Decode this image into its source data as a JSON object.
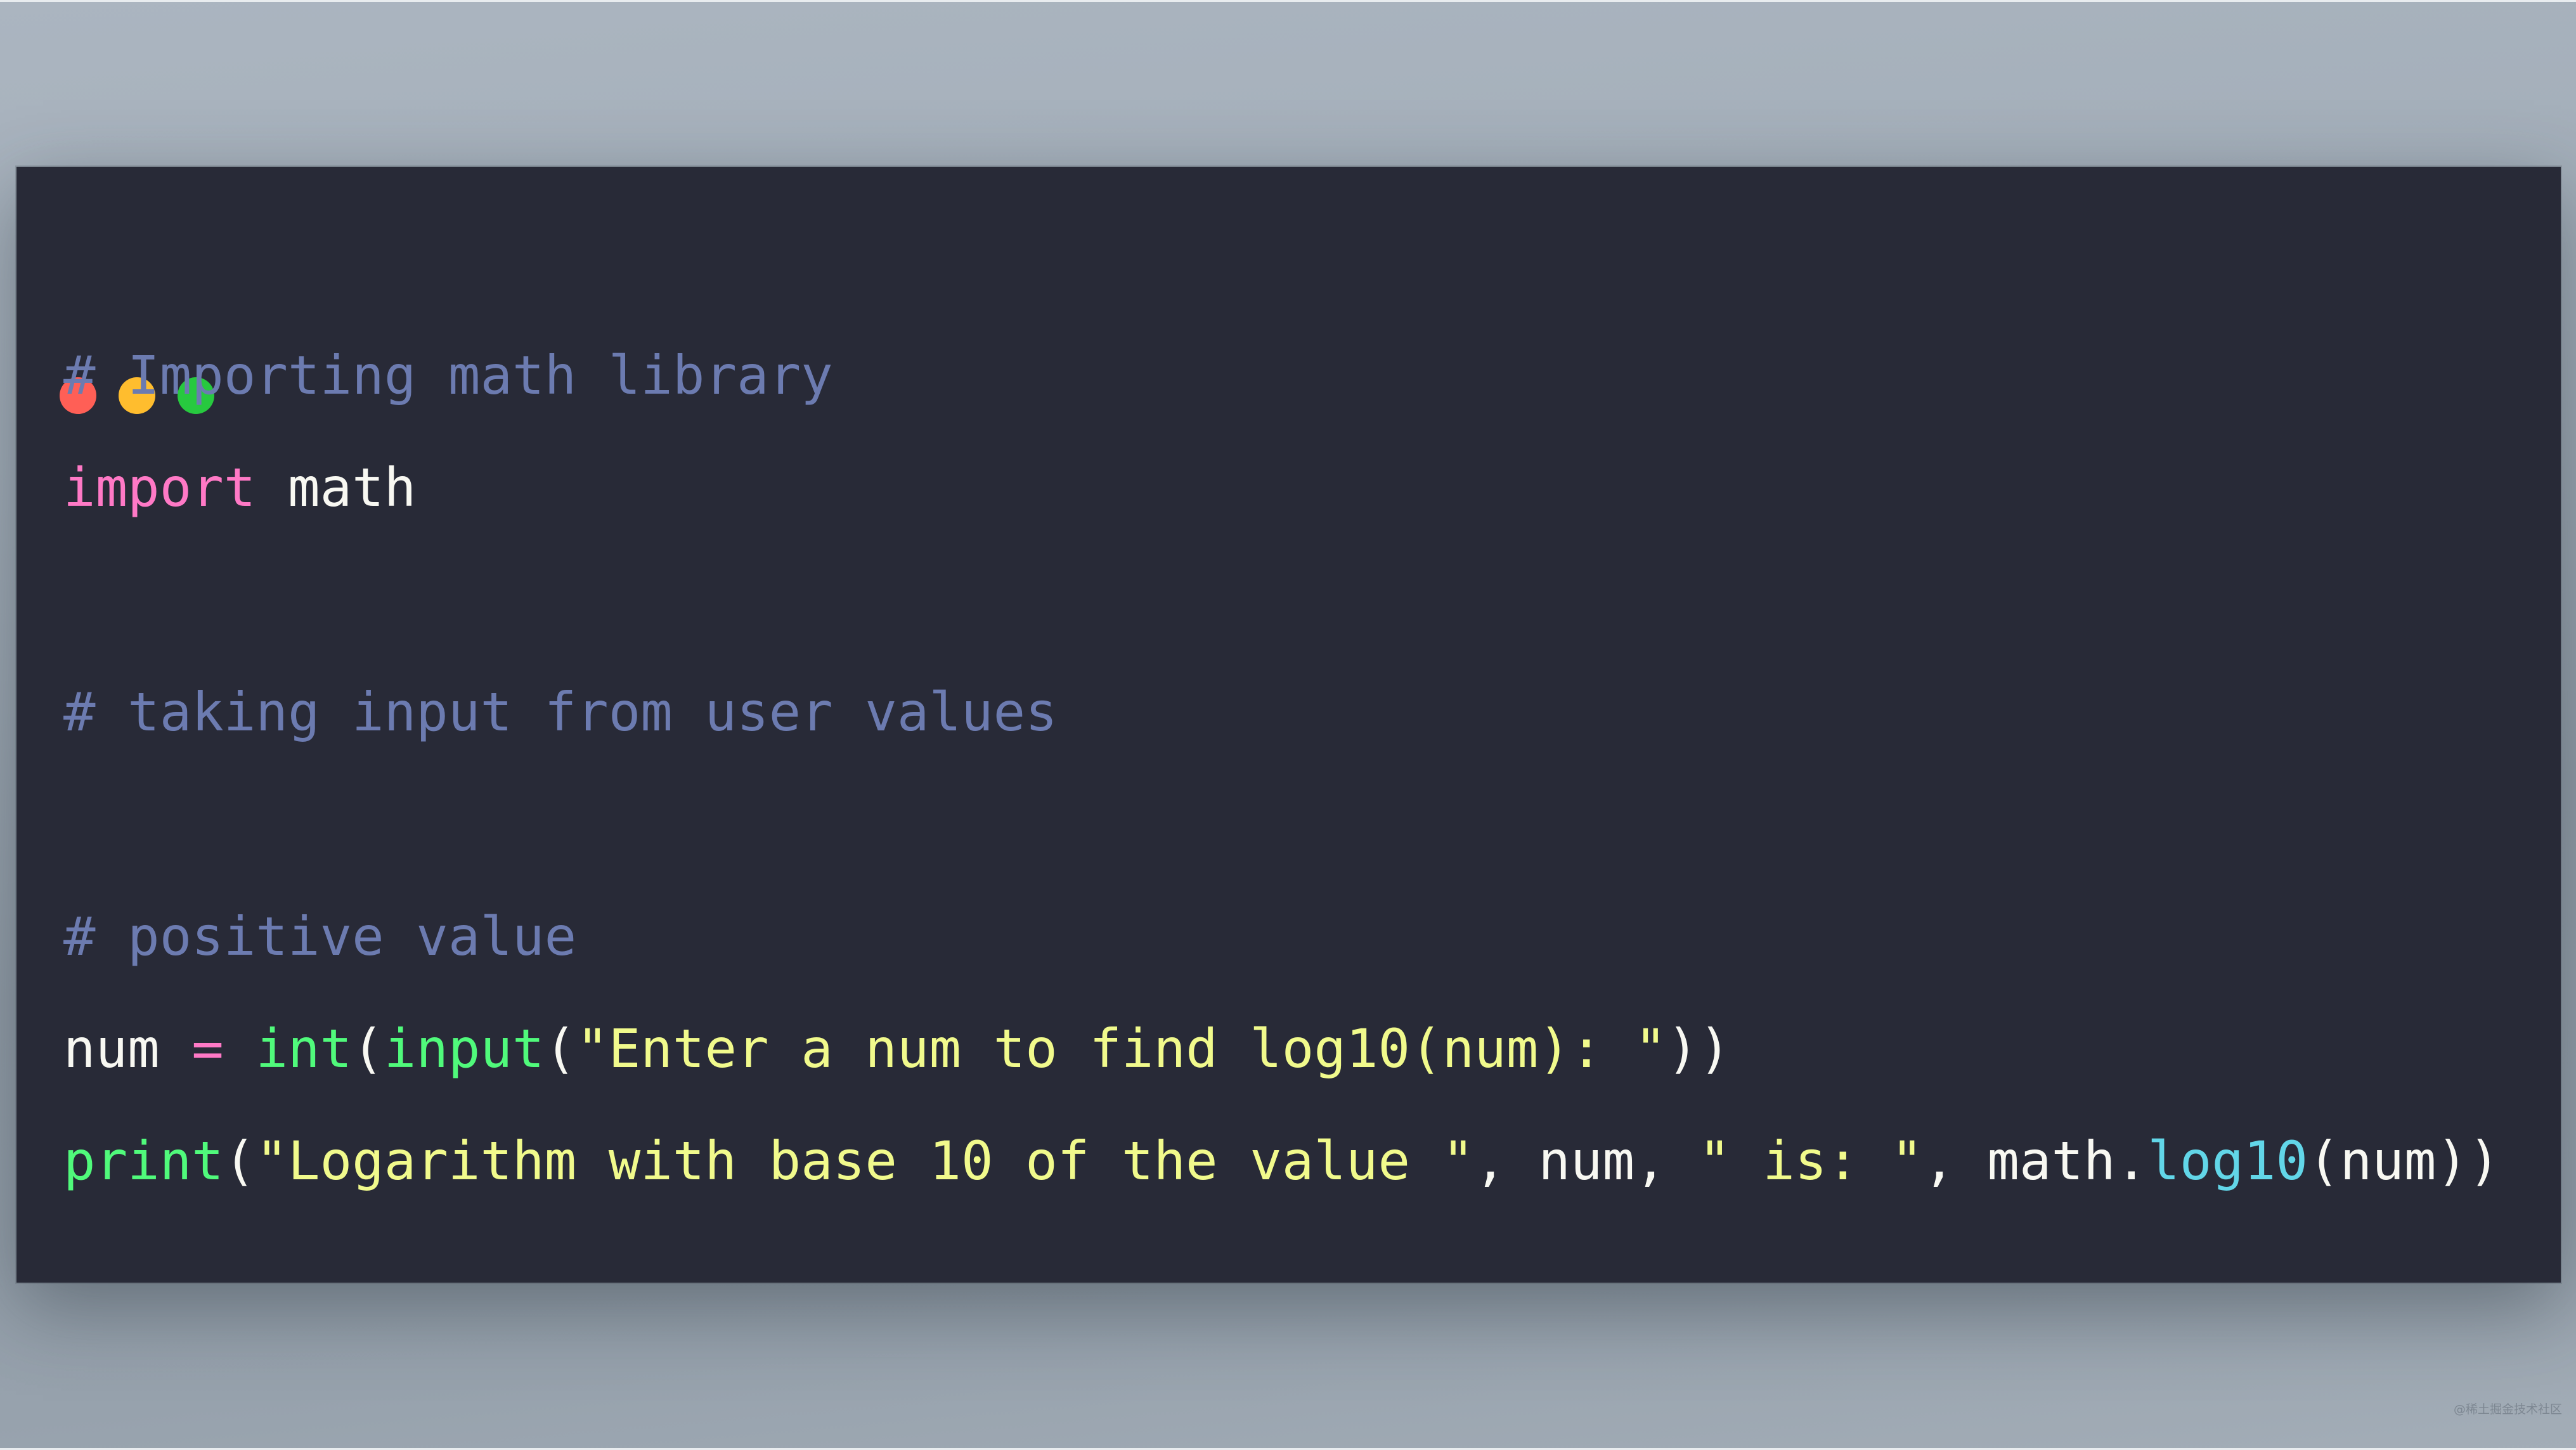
{
  "window": {
    "background": "#282a37",
    "traffic_lights": [
      {
        "name": "close",
        "color": "#ff5f56"
      },
      {
        "name": "minimize",
        "color": "#ffbd2e"
      },
      {
        "name": "maximize",
        "color": "#27c93f"
      }
    ]
  },
  "code": {
    "language": "python",
    "lines": [
      [
        {
          "t": "comment",
          "v": "# Importing math library"
        }
      ],
      [
        {
          "t": "keyword",
          "v": "import"
        },
        {
          "t": "ident",
          "v": " math"
        }
      ],
      [],
      [
        {
          "t": "comment",
          "v": "# taking input from user values"
        }
      ],
      [],
      [
        {
          "t": "comment",
          "v": "# positive value"
        }
      ],
      [
        {
          "t": "ident",
          "v": "num "
        },
        {
          "t": "op",
          "v": "="
        },
        {
          "t": "ident",
          "v": " "
        },
        {
          "t": "builtin",
          "v": "int"
        },
        {
          "t": "punct",
          "v": "("
        },
        {
          "t": "builtin",
          "v": "input"
        },
        {
          "t": "punct",
          "v": "("
        },
        {
          "t": "string",
          "v": "\"Enter a num to find log10(num): \""
        },
        {
          "t": "punct",
          "v": "))"
        }
      ],
      [
        {
          "t": "builtin",
          "v": "print"
        },
        {
          "t": "punct",
          "v": "("
        },
        {
          "t": "string",
          "v": "\"Logarithm with base 10 of the value \""
        },
        {
          "t": "punct",
          "v": ", num, "
        },
        {
          "t": "string",
          "v": "\" is: \""
        },
        {
          "t": "punct",
          "v": ", math."
        },
        {
          "t": "method",
          "v": "log10"
        },
        {
          "t": "punct",
          "v": "(num))"
        }
      ]
    ]
  },
  "watermark": "@稀土掘金技术社区"
}
